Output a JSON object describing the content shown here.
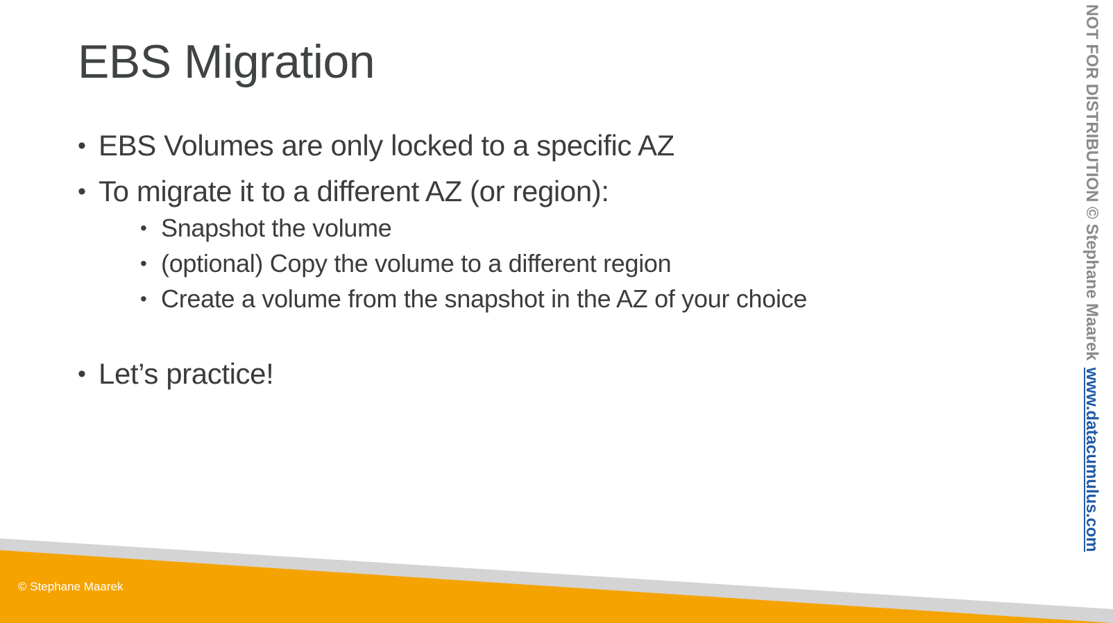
{
  "slide": {
    "title": "EBS Migration",
    "bullets": [
      "EBS Volumes are only locked to a specific AZ",
      "To migrate it to a different AZ (or region):"
    ],
    "sub_bullets": [
      "Snapshot the volume",
      "(optional) Copy the volume to a different region",
      "Create a volume from the snapshot in the AZ of your choice"
    ],
    "final_bullet": "Let’s practice!"
  },
  "footer": {
    "copyright": "© Stephane Maarek",
    "band_color": "#F5A300",
    "shadow_color": "#D4D4D4"
  },
  "watermark": {
    "notice": "NOT FOR DISTRIBUTION © Stephane Maarek",
    "link": "www.datacumulus.com"
  }
}
